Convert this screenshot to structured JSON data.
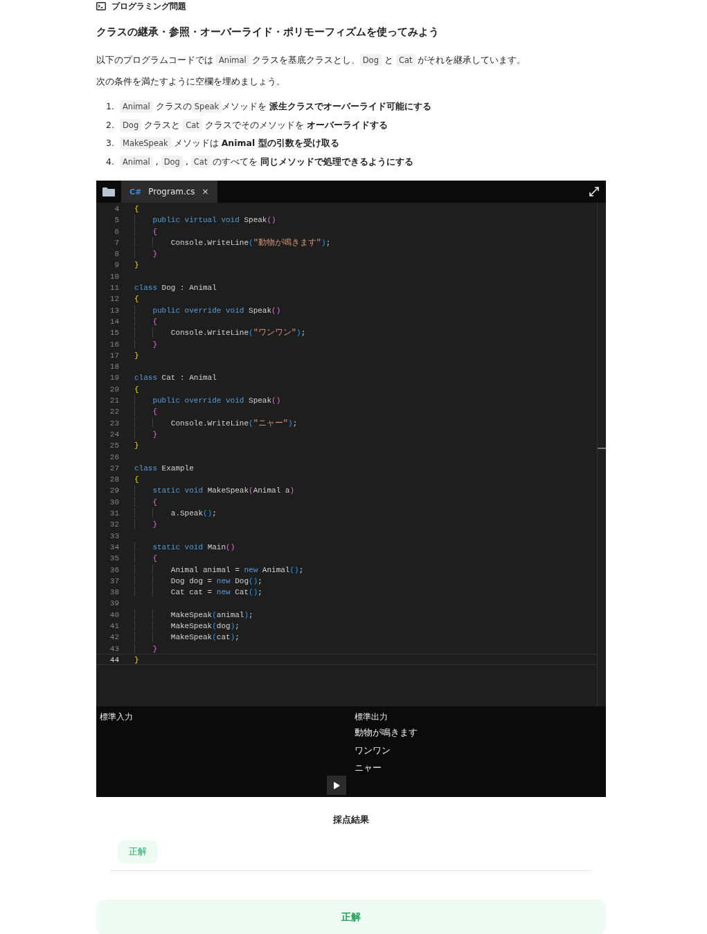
{
  "header": {
    "label": "プログラミング問題"
  },
  "title": "クラスの継承・参照・オーバーライド・ポリモーフィズムを使ってみよう",
  "paragraphs": [
    [
      {
        "kind": "text",
        "text": "以下のプログラムコードでは "
      },
      {
        "kind": "code",
        "text": "Animal"
      },
      {
        "kind": "text",
        "text": " クラスを基底クラスとし、"
      },
      {
        "kind": "code",
        "text": "Dog"
      },
      {
        "kind": "text",
        "text": " と "
      },
      {
        "kind": "code",
        "text": "Cat"
      },
      {
        "kind": "text",
        "text": " がそれを継承しています。"
      }
    ],
    [
      {
        "kind": "text",
        "text": "次の条件を満たすように空欄を埋めましょう。"
      }
    ]
  ],
  "conditions": [
    {
      "number": "1.",
      "parts": [
        {
          "kind": "code",
          "text": "Animal"
        },
        {
          "kind": "text",
          "text": " クラスの"
        },
        {
          "kind": "code",
          "text": "Speak"
        },
        {
          "kind": "text",
          "text": "メソッドを "
        },
        {
          "kind": "bold",
          "text": "派生クラスでオーバーライド可能にする"
        }
      ]
    },
    {
      "number": "2.",
      "parts": [
        {
          "kind": "code",
          "text": "Dog"
        },
        {
          "kind": "text",
          "text": " クラスと "
        },
        {
          "kind": "code",
          "text": "Cat"
        },
        {
          "kind": "text",
          "text": " クラスでそのメソッドを "
        },
        {
          "kind": "bold",
          "text": "オーバーライドする"
        }
      ]
    },
    {
      "number": "3.",
      "parts": [
        {
          "kind": "code",
          "text": "MakeSpeak"
        },
        {
          "kind": "text",
          "text": " メソッドは "
        },
        {
          "kind": "bold",
          "text": "Animal 型の引数を受け取る"
        }
      ]
    },
    {
      "number": "4.",
      "parts": [
        {
          "kind": "code",
          "text": "Animal"
        },
        {
          "kind": "text",
          "text": " , "
        },
        {
          "kind": "code",
          "text": "Dog"
        },
        {
          "kind": "text",
          "text": " , "
        },
        {
          "kind": "code",
          "text": "Cat"
        },
        {
          "kind": "text",
          "text": " のすべてを "
        },
        {
          "kind": "bold",
          "text": "同じメソッドで処理できるようにする"
        }
      ]
    }
  ],
  "editor": {
    "tabs": [
      {
        "icon": "C#",
        "label": "Program.cs",
        "close": "×",
        "selected": true
      }
    ],
    "lines": [
      {
        "number": "4",
        "current": false,
        "tokens": [
          {
            "kind": "b1",
            "text": "{"
          }
        ]
      },
      {
        "number": "5",
        "current": false,
        "tokens": [
          {
            "kind": "kw",
            "text": "    public virtual void "
          },
          {
            "kind": "id",
            "text": "Speak"
          },
          {
            "kind": "b2",
            "text": "()"
          }
        ]
      },
      {
        "number": "6",
        "current": false,
        "tokens": [
          {
            "kind": "b2",
            "text": "    {"
          }
        ]
      },
      {
        "number": "7",
        "current": false,
        "tokens": [
          {
            "kind": "id",
            "text": "        Console.WriteLine"
          },
          {
            "kind": "b3",
            "text": "("
          },
          {
            "kind": "str",
            "text": "\"動物が鳴きます\""
          },
          {
            "kind": "b3",
            "text": ")"
          },
          {
            "kind": "id",
            "text": ";"
          }
        ]
      },
      {
        "number": "8",
        "current": false,
        "tokens": [
          {
            "kind": "b2",
            "text": "    }"
          }
        ]
      },
      {
        "number": "9",
        "current": false,
        "tokens": [
          {
            "kind": "b1",
            "text": "}"
          }
        ]
      },
      {
        "number": "10",
        "current": false
      },
      {
        "number": "11",
        "current": false,
        "tokens": [
          {
            "kind": "kw",
            "text": "class "
          },
          {
            "kind": "id",
            "text": "Dog : Animal"
          }
        ]
      },
      {
        "number": "12",
        "current": false,
        "tokens": [
          {
            "kind": "b1",
            "text": "{"
          }
        ]
      },
      {
        "number": "13",
        "current": false,
        "tokens": [
          {
            "kind": "kw",
            "text": "    public override void "
          },
          {
            "kind": "id",
            "text": "Speak"
          },
          {
            "kind": "b2",
            "text": "()"
          }
        ]
      },
      {
        "number": "14",
        "current": false,
        "tokens": [
          {
            "kind": "b2",
            "text": "    {"
          }
        ]
      },
      {
        "number": "15",
        "current": false,
        "tokens": [
          {
            "kind": "id",
            "text": "        Console.WriteLine"
          },
          {
            "kind": "b3",
            "text": "("
          },
          {
            "kind": "str",
            "text": "\"ワンワン\""
          },
          {
            "kind": "b3",
            "text": ")"
          },
          {
            "kind": "id",
            "text": ";"
          }
        ]
      },
      {
        "number": "16",
        "current": false,
        "tokens": [
          {
            "kind": "b2",
            "text": "    }"
          }
        ]
      },
      {
        "number": "17",
        "current": false,
        "tokens": [
          {
            "kind": "b1",
            "text": "}"
          }
        ]
      },
      {
        "number": "18",
        "current": false
      },
      {
        "number": "19",
        "current": false,
        "tokens": [
          {
            "kind": "kw",
            "text": "class "
          },
          {
            "kind": "id",
            "text": "Cat : Animal"
          }
        ]
      },
      {
        "number": "20",
        "current": false,
        "tokens": [
          {
            "kind": "b1",
            "text": "{"
          }
        ]
      },
      {
        "number": "21",
        "current": false,
        "tokens": [
          {
            "kind": "kw",
            "text": "    public override void "
          },
          {
            "kind": "id",
            "text": "Speak"
          },
          {
            "kind": "b2",
            "text": "()"
          }
        ]
      },
      {
        "number": "22",
        "current": false,
        "tokens": [
          {
            "kind": "b2",
            "text": "    {"
          }
        ]
      },
      {
        "number": "23",
        "current": false,
        "tokens": [
          {
            "kind": "id",
            "text": "        Console.WriteLine"
          },
          {
            "kind": "b3",
            "text": "("
          },
          {
            "kind": "str",
            "text": "\"ニャー\""
          },
          {
            "kind": "b3",
            "text": ")"
          },
          {
            "kind": "id",
            "text": ";"
          }
        ]
      },
      {
        "number": "24",
        "current": false,
        "tokens": [
          {
            "kind": "b2",
            "text": "    }"
          }
        ]
      },
      {
        "number": "25",
        "current": false,
        "tokens": [
          {
            "kind": "b1",
            "text": "}"
          }
        ]
      },
      {
        "number": "26",
        "current": false
      },
      {
        "number": "27",
        "current": false,
        "tokens": [
          {
            "kind": "kw",
            "text": "class "
          },
          {
            "kind": "id",
            "text": "Example"
          }
        ]
      },
      {
        "number": "28",
        "current": false,
        "tokens": [
          {
            "kind": "b1",
            "text": "{"
          }
        ]
      },
      {
        "number": "29",
        "current": false,
        "tokens": [
          {
            "kind": "kw",
            "text": "    static void "
          },
          {
            "kind": "id",
            "text": "MakeSpeak"
          },
          {
            "kind": "b2",
            "text": "("
          },
          {
            "kind": "id",
            "text": "Animal a"
          },
          {
            "kind": "b2",
            "text": ")"
          }
        ]
      },
      {
        "number": "30",
        "current": false,
        "tokens": [
          {
            "kind": "b2",
            "text": "    {"
          }
        ]
      },
      {
        "number": "31",
        "current": false,
        "tokens": [
          {
            "kind": "id",
            "text": "        a.Speak"
          },
          {
            "kind": "b3",
            "text": "()"
          },
          {
            "kind": "id",
            "text": ";"
          }
        ]
      },
      {
        "number": "32",
        "current": false,
        "tokens": [
          {
            "kind": "b2",
            "text": "    }"
          }
        ]
      },
      {
        "number": "33",
        "current": false
      },
      {
        "number": "34",
        "current": false,
        "tokens": [
          {
            "kind": "kw",
            "text": "    static void "
          },
          {
            "kind": "id",
            "text": "Main"
          },
          {
            "kind": "b2",
            "text": "()"
          }
        ]
      },
      {
        "number": "35",
        "current": false,
        "tokens": [
          {
            "kind": "b2",
            "text": "    {"
          }
        ]
      },
      {
        "number": "36",
        "current": false,
        "tokens": [
          {
            "kind": "id",
            "text": "        Animal animal = "
          },
          {
            "kind": "kw",
            "text": "new "
          },
          {
            "kind": "id",
            "text": "Animal"
          },
          {
            "kind": "b3",
            "text": "()"
          },
          {
            "kind": "id",
            "text": ";"
          }
        ]
      },
      {
        "number": "37",
        "current": false,
        "tokens": [
          {
            "kind": "id",
            "text": "        Dog dog = "
          },
          {
            "kind": "kw",
            "text": "new "
          },
          {
            "kind": "id",
            "text": "Dog"
          },
          {
            "kind": "b3",
            "text": "()"
          },
          {
            "kind": "id",
            "text": ";"
          }
        ]
      },
      {
        "number": "38",
        "current": false,
        "tokens": [
          {
            "kind": "id",
            "text": "        Cat cat = "
          },
          {
            "kind": "kw",
            "text": "new "
          },
          {
            "kind": "id",
            "text": "Cat"
          },
          {
            "kind": "b3",
            "text": "()"
          },
          {
            "kind": "id",
            "text": ";"
          }
        ]
      },
      {
        "number": "39",
        "current": false
      },
      {
        "number": "40",
        "current": false,
        "tokens": [
          {
            "kind": "id",
            "text": "        MakeSpeak"
          },
          {
            "kind": "b3",
            "text": "("
          },
          {
            "kind": "id",
            "text": "animal"
          },
          {
            "kind": "b3",
            "text": ")"
          },
          {
            "kind": "id",
            "text": ";"
          }
        ]
      },
      {
        "number": "41",
        "current": false,
        "tokens": [
          {
            "kind": "id",
            "text": "        MakeSpeak"
          },
          {
            "kind": "b3",
            "text": "("
          },
          {
            "kind": "id",
            "text": "dog"
          },
          {
            "kind": "b3",
            "text": ")"
          },
          {
            "kind": "id",
            "text": ";"
          }
        ]
      },
      {
        "number": "42",
        "current": false,
        "tokens": [
          {
            "kind": "id",
            "text": "        MakeSpeak"
          },
          {
            "kind": "b3",
            "text": "("
          },
          {
            "kind": "id",
            "text": "cat"
          },
          {
            "kind": "b3",
            "text": ")"
          },
          {
            "kind": "id",
            "text": ";"
          }
        ]
      },
      {
        "number": "43",
        "current": false,
        "tokens": [
          {
            "kind": "b2",
            "text": "    }"
          }
        ]
      },
      {
        "number": "44",
        "current": true,
        "tokens": [
          {
            "kind": "b1",
            "text": "}"
          }
        ]
      }
    ]
  },
  "io": {
    "input_label": "標準入力",
    "output_label": "標準出力",
    "output_lines": [
      "動物が鳴きます",
      "ワンワン",
      "ニャー"
    ]
  },
  "result": {
    "title": "採点結果",
    "badge": "正解",
    "banner": "正解"
  }
}
